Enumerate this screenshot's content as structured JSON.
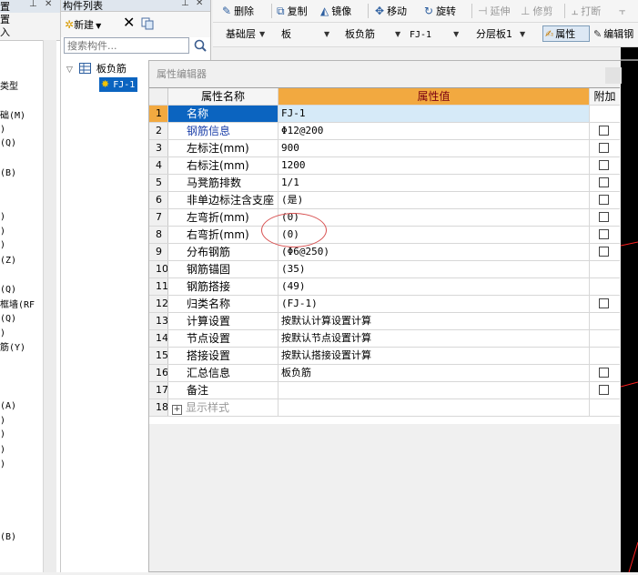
{
  "left_panel": {
    "title": "置",
    "sub_items": [
      "置",
      "入"
    ],
    "tree_items": [
      "类型",
      "础(M)",
      ")",
      "(Q)",
      "(B)",
      ")",
      ")",
      ")",
      "(Z)",
      "(Q)",
      "框墙(RF",
      "(Q)",
      ")",
      "筋(Y)",
      "(A)",
      ")",
      ")",
      ")",
      ")",
      "(B)"
    ]
  },
  "component_list": {
    "title": "构件列表",
    "new_label": "新建",
    "search_placeholder": "搜索构件...",
    "tree_root": "板负筋",
    "tree_child": "FJ-1"
  },
  "toolbar": {
    "items": [
      {
        "label": "删除",
        "icon": "eraser-icon"
      },
      {
        "label": "复制",
        "icon": "copy-icon"
      },
      {
        "label": "镜像",
        "icon": "mirror-icon"
      },
      {
        "label": "移动",
        "icon": "move-icon"
      },
      {
        "label": "旋转",
        "icon": "rotate-icon"
      },
      {
        "label": "延伸",
        "icon": "extend-icon"
      },
      {
        "label": "修剪",
        "icon": "trim-icon"
      },
      {
        "label": "打断",
        "icon": "break-icon"
      }
    ]
  },
  "filters": {
    "floor": "基础层",
    "category": "板",
    "type": "板负筋",
    "component": "FJ-1",
    "layer": "分层板1",
    "property_label": "属性",
    "edit_label": "编辑钢"
  },
  "editor": {
    "title": "属性编辑器",
    "col_name": "属性名称",
    "col_value": "属性值",
    "col_extra": "附加",
    "rows": [
      {
        "num": "1",
        "name": "名称",
        "value": "FJ-1",
        "checkbox": false,
        "checked": false,
        "selected": true,
        "blue": false,
        "expand": false
      },
      {
        "num": "2",
        "name": "钢筋信息",
        "value": "Φ12@200",
        "checkbox": true,
        "checked": false,
        "selected": false,
        "blue": true,
        "expand": false
      },
      {
        "num": "3",
        "name": "左标注(mm)",
        "value": "900",
        "checkbox": true,
        "checked": false,
        "selected": false,
        "blue": false,
        "expand": false
      },
      {
        "num": "4",
        "name": "右标注(mm)",
        "value": "1200",
        "checkbox": true,
        "checked": false,
        "selected": false,
        "blue": false,
        "expand": false
      },
      {
        "num": "5",
        "name": "马凳筋排数",
        "value": "1/1",
        "checkbox": true,
        "checked": false,
        "selected": false,
        "blue": false,
        "expand": false
      },
      {
        "num": "6",
        "name": "非单边标注含支座",
        "value": "(是)",
        "checkbox": true,
        "checked": false,
        "selected": false,
        "blue": false,
        "expand": false
      },
      {
        "num": "7",
        "name": "左弯折(mm)",
        "value": "(0)",
        "checkbox": true,
        "checked": false,
        "selected": false,
        "blue": false,
        "expand": false
      },
      {
        "num": "8",
        "name": "右弯折(mm)",
        "value": "(0)",
        "checkbox": true,
        "checked": false,
        "selected": false,
        "blue": false,
        "expand": false
      },
      {
        "num": "9",
        "name": "分布钢筋",
        "value": "(Φ6@250)",
        "checkbox": true,
        "checked": false,
        "selected": false,
        "blue": false,
        "expand": false
      },
      {
        "num": "10",
        "name": "钢筋锚固",
        "value": "(35)",
        "checkbox": false,
        "checked": false,
        "selected": false,
        "blue": false,
        "expand": false
      },
      {
        "num": "11",
        "name": "钢筋搭接",
        "value": "(49)",
        "checkbox": false,
        "checked": false,
        "selected": false,
        "blue": false,
        "expand": false
      },
      {
        "num": "12",
        "name": "归类名称",
        "value": "(FJ-1)",
        "checkbox": true,
        "checked": false,
        "selected": false,
        "blue": false,
        "expand": false
      },
      {
        "num": "13",
        "name": "计算设置",
        "value": "按默认计算设置计算",
        "checkbox": false,
        "checked": false,
        "selected": false,
        "blue": false,
        "expand": false
      },
      {
        "num": "14",
        "name": "节点设置",
        "value": "按默认节点设置计算",
        "checkbox": false,
        "checked": false,
        "selected": false,
        "blue": false,
        "expand": false
      },
      {
        "num": "15",
        "name": "搭接设置",
        "value": "按默认搭接设置计算",
        "checkbox": false,
        "checked": false,
        "selected": false,
        "blue": false,
        "expand": false
      },
      {
        "num": "16",
        "name": "汇总信息",
        "value": "板负筋",
        "checkbox": true,
        "checked": false,
        "selected": false,
        "blue": false,
        "expand": false
      },
      {
        "num": "17",
        "name": "备注",
        "value": "",
        "checkbox": true,
        "checked": false,
        "selected": false,
        "blue": false,
        "expand": false
      },
      {
        "num": "18",
        "name": "显示样式",
        "value": "",
        "checkbox": false,
        "checked": false,
        "selected": false,
        "blue": false,
        "expand": true
      }
    ]
  },
  "colors": {
    "accent": "#0b64c0",
    "header_value": "#f2a940",
    "annotation": "#d85050",
    "canvas": "#000000"
  }
}
